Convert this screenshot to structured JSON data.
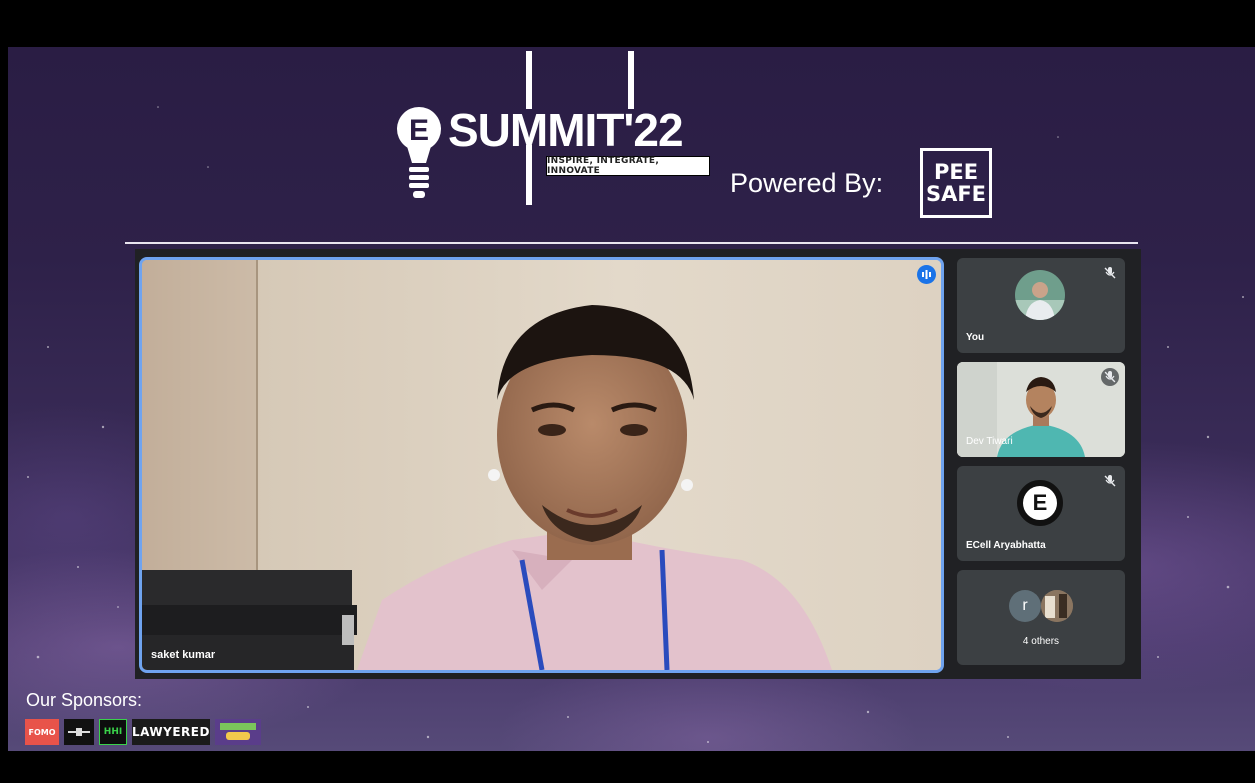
{
  "header": {
    "logo_e": "E",
    "logo_text": "SUMMIT",
    "logo_year": "'22",
    "tagline": "INSPIRE, INTEGRATE, INNOVATE",
    "powered_by": "Powered By:",
    "brand_line1": "PEE",
    "brand_line2": "SAFE"
  },
  "meet": {
    "main_speaker": {
      "name": "saket kumar",
      "speaking": true
    },
    "participants": [
      {
        "name": "You",
        "muted": true,
        "type": "avatar-photo"
      },
      {
        "name": "Dev Tiwari",
        "muted": true,
        "type": "video"
      },
      {
        "name": "ECell Aryabhatta",
        "muted": true,
        "type": "avatar-letter",
        "initial": "E"
      },
      {
        "name": "4 others",
        "type": "others",
        "initial": "r"
      }
    ]
  },
  "sponsors": {
    "title": "Our Sponsors:",
    "items": [
      {
        "label": "FOMO",
        "color": "#e8534a"
      },
      {
        "label": "",
        "color": "#111111"
      },
      {
        "label": "HHI",
        "color": "#0d0d0d"
      },
      {
        "label": "LAWYERED",
        "color": "#1b1b1b"
      },
      {
        "label": "",
        "color": "#5a3d8a"
      }
    ]
  },
  "colors": {
    "accent": "#1a73e8",
    "tile": "#3c4043",
    "panel": "#202124",
    "highlight": "#6fa3ef"
  }
}
